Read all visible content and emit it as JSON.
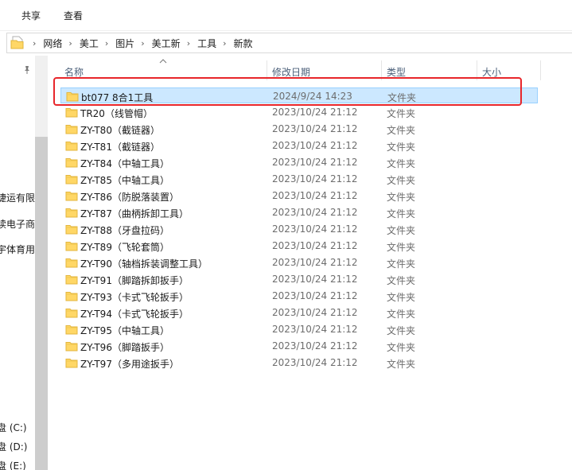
{
  "ribbon": {
    "tabs": [
      "共享",
      "查看"
    ]
  },
  "address": {
    "folder_icon": "folder-icon",
    "breadcrumbs": [
      "网络",
      "美工",
      "图片",
      "美工新",
      "工具",
      "新款"
    ]
  },
  "nav": {
    "pin_icon": "pin-icon",
    "items": [
      "捷运有限",
      "读电子商",
      "宇体育用",
      "盘 (C:)",
      "盘 (D:)",
      "盘 (E:)"
    ]
  },
  "columns": {
    "name": "名称",
    "modified": "修改日期",
    "type": "类型",
    "size": "大小"
  },
  "colors": {
    "selection_bg": "#cce8ff",
    "selection_border": "#99d1ff",
    "annotation": "#e8262b",
    "folder": "#ffd766"
  },
  "files": [
    {
      "name": "bt077 8合1工具",
      "date": "2024/9/24 14:23",
      "type": "文件夹",
      "selected": true
    },
    {
      "name": "TR20（线管帽）",
      "date": "2023/10/24 21:12",
      "type": "文件夹"
    },
    {
      "name": "ZY-T80（截链器）",
      "date": "2023/10/24 21:12",
      "type": "文件夹"
    },
    {
      "name": "ZY-T81（截链器）",
      "date": "2023/10/24 21:12",
      "type": "文件夹"
    },
    {
      "name": "ZY-T84（中轴工具）",
      "date": "2023/10/24 21:12",
      "type": "文件夹"
    },
    {
      "name": "ZY-T85（中轴工具）",
      "date": "2023/10/24 21:12",
      "type": "文件夹"
    },
    {
      "name": "ZY-T86（防脱落装置）",
      "date": "2023/10/24 21:12",
      "type": "文件夹"
    },
    {
      "name": "ZY-T87（曲柄拆卸工具）",
      "date": "2023/10/24 21:12",
      "type": "文件夹"
    },
    {
      "name": "ZY-T88（牙盘拉码）",
      "date": "2023/10/24 21:12",
      "type": "文件夹"
    },
    {
      "name": "ZY-T89（飞轮套筒）",
      "date": "2023/10/24 21:12",
      "type": "文件夹"
    },
    {
      "name": "ZY-T90（轴档拆装调整工具）",
      "date": "2023/10/24 21:12",
      "type": "文件夹"
    },
    {
      "name": "ZY-T91（脚踏拆卸扳手）",
      "date": "2023/10/24 21:12",
      "type": "文件夹"
    },
    {
      "name": "ZY-T93（卡式飞轮扳手）",
      "date": "2023/10/24 21:12",
      "type": "文件夹"
    },
    {
      "name": "ZY-T94（卡式飞轮扳手）",
      "date": "2023/10/24 21:12",
      "type": "文件夹"
    },
    {
      "name": "ZY-T95（中轴工具）",
      "date": "2023/10/24 21:12",
      "type": "文件夹"
    },
    {
      "name": "ZY-T96（脚踏扳手）",
      "date": "2023/10/24 21:12",
      "type": "文件夹"
    },
    {
      "name": "ZY-T97（多用途扳手）",
      "date": "2023/10/24 21:12",
      "type": "文件夹"
    }
  ]
}
